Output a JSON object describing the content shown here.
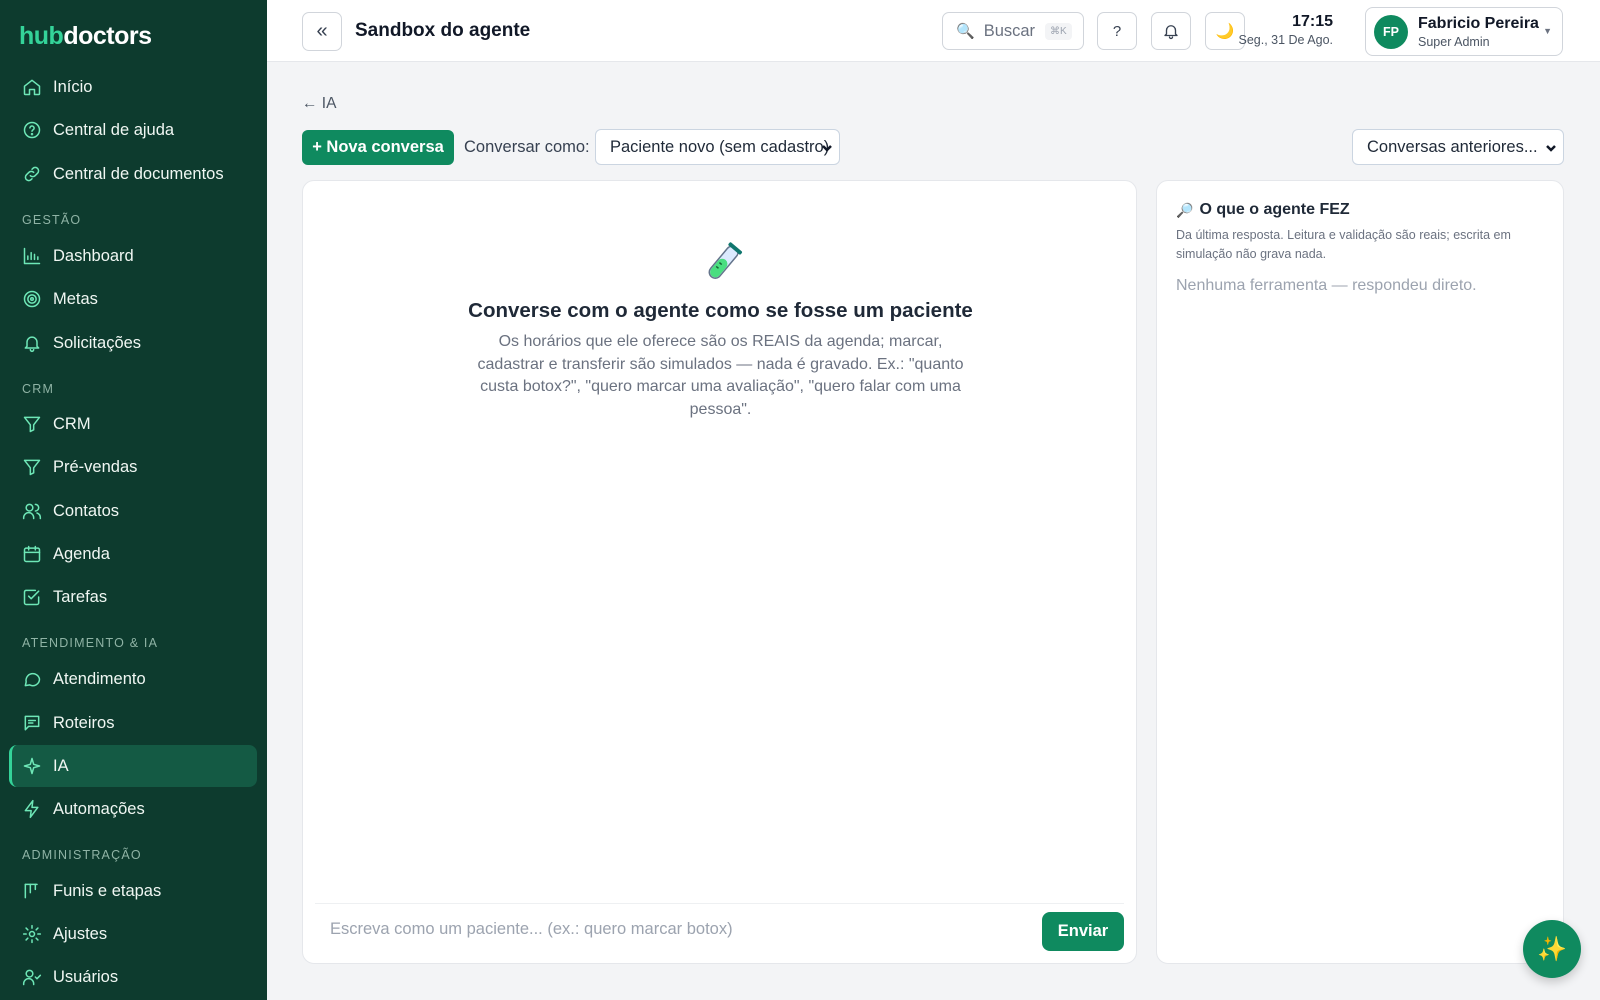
{
  "brand": {
    "part1": "hub",
    "part2": "doctors"
  },
  "sidebar": {
    "items": [
      {
        "label": "Início",
        "icon": "home-icon"
      },
      {
        "label": "Central de ajuda",
        "icon": "help-circle-icon"
      },
      {
        "label": "Central de documentos",
        "icon": "link-icon"
      }
    ],
    "sections": [
      {
        "title": "GESTÃO",
        "items": [
          {
            "label": "Dashboard",
            "icon": "bar-chart-icon"
          },
          {
            "label": "Metas",
            "icon": "target-icon"
          },
          {
            "label": "Solicitações",
            "icon": "bell-icon"
          }
        ]
      },
      {
        "title": "CRM",
        "items": [
          {
            "label": "CRM",
            "icon": "filter-icon"
          },
          {
            "label": "Pré-vendas",
            "icon": "filter-icon"
          },
          {
            "label": "Contatos",
            "icon": "users-icon"
          },
          {
            "label": "Agenda",
            "icon": "calendar-icon"
          },
          {
            "label": "Tarefas",
            "icon": "check-square-icon"
          }
        ]
      },
      {
        "title": "ATENDIMENTO & IA",
        "items": [
          {
            "label": "Atendimento",
            "icon": "chat-bubble-icon"
          },
          {
            "label": "Roteiros",
            "icon": "message-square-icon"
          },
          {
            "label": "IA",
            "icon": "sparkle-icon",
            "active": true
          },
          {
            "label": "Automações",
            "icon": "lightning-icon"
          }
        ]
      },
      {
        "title": "ADMINISTRAÇÃO",
        "items": [
          {
            "label": "Funis e etapas",
            "icon": "kanban-icon"
          },
          {
            "label": "Ajustes",
            "icon": "gear-icon"
          },
          {
            "label": "Usuários",
            "icon": "user-check-icon"
          }
        ]
      }
    ]
  },
  "header": {
    "collapse_label": "«",
    "title": "Sandbox do agente",
    "search": {
      "label": "Buscar",
      "shortcut": "⌘K"
    },
    "help_label": "?",
    "time": "17:15",
    "date": "Seg., 31 De Ago.",
    "user": {
      "initials": "FP",
      "name": "Fabricio Pereira",
      "role": "Super Admin"
    }
  },
  "main": {
    "back_label": "← IA",
    "new_conversation_label": "+ Nova conversa",
    "converse_as_label": "Conversar como:",
    "converse_as_value": "Paciente novo (sem cadastro)",
    "previous_conversations_label": "Conversas anteriores...",
    "chat": {
      "empty_title": "Converse com o agente como se fosse um paciente",
      "empty_text": "Os horários que ele oferece são os REAIS da agenda; marcar, cadastrar e transferir são simulados — nada é gravado. Ex.: \"quanto custa botox?\", \"quero marcar uma avaliação\", \"quero falar com uma pessoa\".",
      "input_placeholder": "Escreva como um paciente... (ex.: quero marcar botox)",
      "send_label": "Enviar"
    },
    "agent_panel": {
      "title": "O que o agente FEZ",
      "description": "Da última resposta. Leitura e validação são reais; escrita em simulação não grava nada.",
      "empty": "Nenhuma ferramenta — respondeu direto."
    }
  },
  "colors": {
    "sidebar_bg": "#0d3b2e",
    "accent": "#0f8a5f",
    "accent_light": "#34d399"
  }
}
